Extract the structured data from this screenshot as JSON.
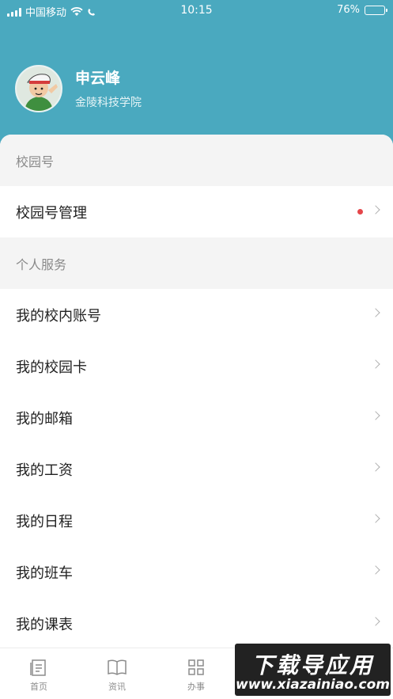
{
  "status_bar": {
    "carrier": "中国移动",
    "time": "10:15",
    "battery": "76%",
    "battery_level": 0.76
  },
  "profile": {
    "name": "申云峰",
    "school": "金陵科技学院"
  },
  "sections": [
    {
      "header": "校园号",
      "items": [
        {
          "label": "校园号管理",
          "has_dot": true
        }
      ]
    },
    {
      "header": "个人服务",
      "items": [
        {
          "label": "我的校内账号"
        },
        {
          "label": "我的校园卡"
        },
        {
          "label": "我的邮箱"
        },
        {
          "label": "我的工资"
        },
        {
          "label": "我的日程"
        },
        {
          "label": "我的班车"
        },
        {
          "label": "我的课表"
        }
      ]
    }
  ],
  "tabs": [
    {
      "label": "首页",
      "icon": "document-icon"
    },
    {
      "label": "资讯",
      "icon": "book-icon"
    },
    {
      "label": "办事",
      "icon": "grid-icon"
    }
  ],
  "watermark": {
    "line1": "下载导应用",
    "line2": "www.xiazainiao.com"
  },
  "colors": {
    "header_bg": "#4aa9bf",
    "badge_dot": "#e5464a"
  }
}
